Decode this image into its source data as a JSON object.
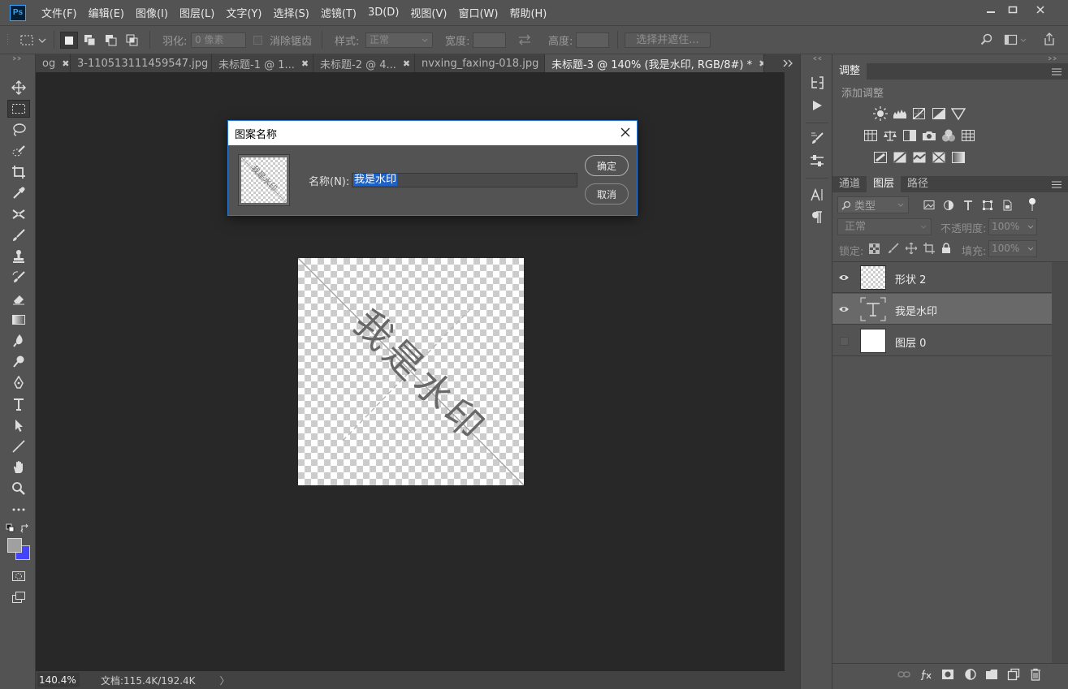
{
  "app": {
    "logo": "Ps"
  },
  "menu": [
    "文件(F)",
    "编辑(E)",
    "图像(I)",
    "图层(L)",
    "文字(Y)",
    "选择(S)",
    "滤镜(T)",
    "3D(D)",
    "视图(V)",
    "窗口(W)",
    "帮助(H)"
  ],
  "options": {
    "feather_label": "羽化:",
    "feather_value": "0 像素",
    "antialias_label": "消除锯齿",
    "style_label": "样式:",
    "style_value": "正常",
    "width_label": "宽度:",
    "height_label": "高度:",
    "select_mask_label": "选择并遮住..."
  },
  "tabs": [
    {
      "label": "og",
      "closable": true,
      "active": false
    },
    {
      "label": "3-110513111459547.jpg",
      "closable": true,
      "active": false
    },
    {
      "label": "未标题-1 @ 1...",
      "closable": true,
      "active": false
    },
    {
      "label": "未标题-2 @ 4...",
      "closable": true,
      "active": false
    },
    {
      "label": "nvxing_faxing-018.jpg",
      "closable": true,
      "active": false
    },
    {
      "label": "未标题-3 @ 140% (我是水印, RGB/8#) *",
      "closable": true,
      "active": true
    }
  ],
  "canvas": {
    "watermark_text": "我是水印"
  },
  "status": {
    "zoom": "140.4%",
    "doc_info": "文档:115.4K/192.4K",
    "arrow": "〉"
  },
  "dialog": {
    "title": "图案名称",
    "name_label": "名称(N):",
    "name_value": "我是水印",
    "ok_label": "确定",
    "cancel_label": "取消",
    "preview_text": "我是水印"
  },
  "adjustments": {
    "tab_label": "调整",
    "add_label": "添加调整"
  },
  "layers_panel": {
    "tabs": [
      "通道",
      "图层",
      "路径"
    ],
    "active_tab": "图层",
    "filter_label": "类型",
    "blend_mode": "正常",
    "opacity_label": "不透明度:",
    "opacity_value": "100%",
    "lock_label": "锁定:",
    "fill_label": "填充:",
    "fill_value": "100%",
    "layers": [
      {
        "name": "形状 2",
        "visible": true,
        "selected": false,
        "thumb": "checker"
      },
      {
        "name": "我是水印",
        "visible": true,
        "selected": true,
        "thumb": "text"
      },
      {
        "name": "图层 0",
        "visible": false,
        "selected": false,
        "thumb": "white"
      }
    ]
  },
  "colors": {
    "foreground": "#a0a0a0",
    "background": "#4444ff",
    "accent": "#1e62c8",
    "ps_blue": "#31a8ff"
  }
}
